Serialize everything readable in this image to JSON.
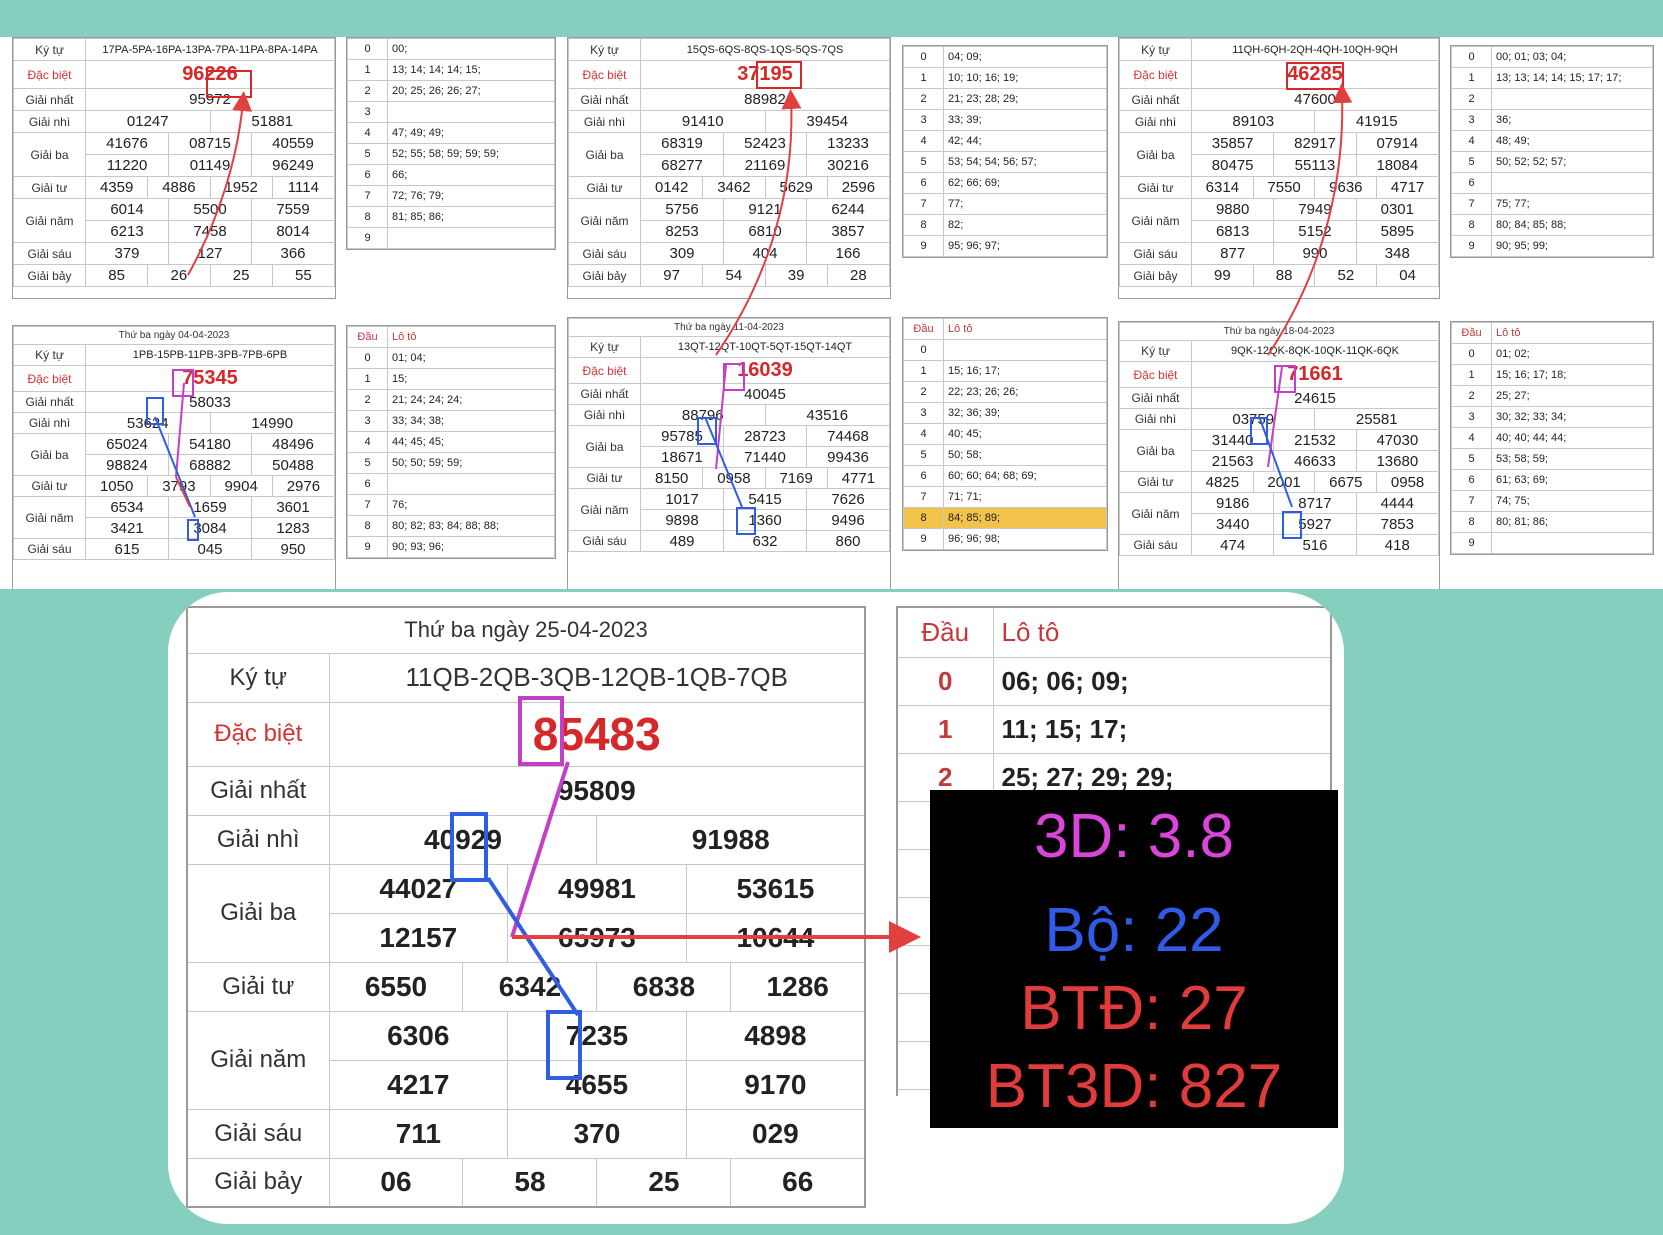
{
  "labels": {
    "ky_tu": "Ký tự",
    "dac_biet": "Đặc biệt",
    "giai_nhat": "Giải nhất",
    "giai_nhi": "Giải nhì",
    "giai_ba": "Giải ba",
    "giai_tu": "Giải tư",
    "giai_nam": "Giải năm",
    "giai_sau": "Giải sáu",
    "giai_bay": "Giải bảy",
    "dau": "Đầu",
    "loto": "Lô tô"
  },
  "cards": [
    {
      "id": "c1",
      "codes": "17PA-5PA-16PA-13PA-7PA-11PA-8PA-14PA",
      "db": "96226",
      "g1": "95972",
      "g2": [
        "01247",
        "51881"
      ],
      "g3": [
        "41676",
        "08715",
        "40559",
        "11220",
        "01149",
        "96249"
      ],
      "g4": [
        "4359",
        "4886",
        "1952",
        "1114"
      ],
      "g5": [
        "6014",
        "5500",
        "7559",
        "6213",
        "7458",
        "8014"
      ],
      "g6": [
        "379",
        "127",
        "366"
      ],
      "g7": [
        "85",
        "26",
        "25",
        "55"
      ]
    },
    {
      "id": "c2",
      "codes": "15QS-6QS-8QS-1QS-5QS-7QS",
      "db": "37195",
      "g1": "88982",
      "g2": [
        "91410",
        "39454"
      ],
      "g3": [
        "68319",
        "52423",
        "13233",
        "68277",
        "21169",
        "30216"
      ],
      "g4": [
        "0142",
        "3462",
        "5629",
        "2596"
      ],
      "g5": [
        "5756",
        "9121",
        "6244",
        "8253",
        "6810",
        "3857"
      ],
      "g6": [
        "309",
        "404",
        "166"
      ],
      "g7": [
        "97",
        "54",
        "39",
        "28"
      ]
    },
    {
      "id": "c3",
      "codes": "11QH-6QH-2QH-4QH-10QH-9QH",
      "db": "46285",
      "g1": "47600",
      "g2": [
        "89103",
        "41915"
      ],
      "g3": [
        "35857",
        "82917",
        "07914",
        "80475",
        "55113",
        "18084"
      ],
      "g4": [
        "6314",
        "7550",
        "9636",
        "4717"
      ],
      "g5": [
        "9880",
        "7949",
        "0301",
        "6813",
        "5152",
        "5895"
      ],
      "g6": [
        "877",
        "990",
        "348"
      ],
      "g7": [
        "99",
        "88",
        "52",
        "04"
      ]
    },
    {
      "id": "c4",
      "date": "Thứ ba ngày 04-04-2023",
      "codes": "1PB-15PB-11PB-3PB-7PB-6PB",
      "db": "75345",
      "g1": "58033",
      "g2": [
        "53624",
        "14990"
      ],
      "g3": [
        "65024",
        "54180",
        "48496",
        "98824",
        "68882",
        "50488"
      ],
      "g4": [
        "1050",
        "3793",
        "9904",
        "2976"
      ],
      "g5": [
        "6534",
        "1659",
        "3601",
        "3421",
        "3084",
        "1283"
      ],
      "g6": [
        "615",
        "045",
        "950"
      ]
    },
    {
      "id": "c5",
      "date": "Thứ ba ngày 11-04-2023",
      "codes": "13QT-12QT-10QT-5QT-15QT-14QT",
      "db": "16039",
      "g1": "40045",
      "g2": [
        "88796",
        "43516"
      ],
      "g3": [
        "95785",
        "28723",
        "74468",
        "18671",
        "71440",
        "99436"
      ],
      "g4": [
        "8150",
        "0958",
        "7169",
        "4771"
      ],
      "g5": [
        "1017",
        "5415",
        "7626",
        "9898",
        "1360",
        "9496"
      ],
      "g6": [
        "489",
        "632",
        "860"
      ]
    },
    {
      "id": "c6",
      "date": "Thứ ba ngày 18-04-2023",
      "codes": "9QK-12QK-8QK-10QK-11QK-6QK",
      "db": "71661",
      "g1": "24615",
      "g2": [
        "03759",
        "25581"
      ],
      "g3": [
        "31440",
        "21532",
        "47030",
        "21563",
        "46633",
        "13680"
      ],
      "g4": [
        "4825",
        "2001",
        "6675",
        "0958"
      ],
      "g5": [
        "9186",
        "8717",
        "4444",
        "3440",
        "5927",
        "7853"
      ],
      "g6": [
        "474",
        "516",
        "418"
      ]
    }
  ],
  "lotos": [
    {
      "id": "l1",
      "rows": [
        [
          "0",
          "00;"
        ],
        [
          "1",
          "13; 14; 14; 14; 15;"
        ],
        [
          "2",
          "20; 25; 26; 26; 27;"
        ],
        [
          "3",
          ""
        ],
        [
          "4",
          "47; 49; 49;"
        ],
        [
          "5",
          "52; 55; 58; 59; 59; 59;"
        ],
        [
          "6",
          "66;"
        ],
        [
          "7",
          "72; 76; 79;"
        ],
        [
          "8",
          "81; 85; 86;"
        ],
        [
          "9",
          ""
        ]
      ]
    },
    {
      "id": "l2",
      "rows": [
        [
          "0",
          "04; 09;"
        ],
        [
          "1",
          "10; 10; 16; 19;"
        ],
        [
          "2",
          "21; 23; 28; 29;"
        ],
        [
          "3",
          "33; 39;"
        ],
        [
          "4",
          "42; 44;"
        ],
        [
          "5",
          "53; 54; 54; 56; 57;"
        ],
        [
          "6",
          "62; 66; 69;"
        ],
        [
          "7",
          "77;"
        ],
        [
          "8",
          "82;"
        ],
        [
          "9",
          "95; 96; 97;"
        ]
      ]
    },
    {
      "id": "l3",
      "rows": [
        [
          "0",
          "00; 01; 03; 04;"
        ],
        [
          "1",
          "13; 13; 14; 14; 15; 17; 17;"
        ],
        [
          "2",
          ""
        ],
        [
          "3",
          "36;"
        ],
        [
          "4",
          "48; 49;"
        ],
        [
          "5",
          "50; 52; 52; 57;"
        ],
        [
          "6",
          ""
        ],
        [
          "7",
          "75; 77;"
        ],
        [
          "8",
          "80; 84; 85; 88;"
        ],
        [
          "9",
          "90; 95; 99;"
        ]
      ]
    },
    {
      "id": "l4",
      "rows": [
        [
          "0",
          "01; 04;"
        ],
        [
          "1",
          "15;"
        ],
        [
          "2",
          "21; 24; 24; 24;"
        ],
        [
          "3",
          "33; 34; 38;"
        ],
        [
          "4",
          "44; 45; 45;"
        ],
        [
          "5",
          "50; 50; 59; 59;"
        ],
        [
          "6",
          ""
        ],
        [
          "7",
          "76;"
        ],
        [
          "8",
          "80; 82; 83; 84; 88; 88;"
        ],
        [
          "9",
          "90; 93; 96;"
        ]
      ]
    },
    {
      "id": "l5",
      "rows": [
        [
          "0",
          ""
        ],
        [
          "1",
          "15; 16; 17;"
        ],
        [
          "2",
          "22; 23; 26; 26;"
        ],
        [
          "3",
          "32; 36; 39;"
        ],
        [
          "4",
          "40; 45;"
        ],
        [
          "5",
          "50; 58;"
        ],
        [
          "6",
          "60; 60; 64; 68; 69;"
        ],
        [
          "7",
          "71; 71;"
        ],
        [
          "8",
          "84; 85; 89;"
        ],
        [
          "9",
          "96; 96; 98;"
        ]
      ]
    },
    {
      "id": "l6",
      "rows": [
        [
          "0",
          "01; 02;"
        ],
        [
          "1",
          "15; 16; 17; 18;"
        ],
        [
          "2",
          "25; 27;"
        ],
        [
          "3",
          "30; 32; 33; 34;"
        ],
        [
          "4",
          "40; 40; 44; 44;"
        ],
        [
          "5",
          "53; 58; 59;"
        ],
        [
          "6",
          "61; 63; 69;"
        ],
        [
          "7",
          "74; 75;"
        ],
        [
          "8",
          "80; 81; 86;"
        ],
        [
          "9",
          ""
        ]
      ]
    }
  ],
  "big": {
    "date": "Thứ ba ngày 25-04-2023",
    "codes": "11QB-2QB-3QB-12QB-1QB-7QB",
    "db": "85483",
    "g1": "95809",
    "g2": [
      "40929",
      "91988"
    ],
    "g3": [
      "44027",
      "49981",
      "53615",
      "12157",
      "65973",
      "10644"
    ],
    "g4": [
      "6550",
      "6342",
      "6838",
      "1286"
    ],
    "g5": [
      "6306",
      "7235",
      "4898",
      "4217",
      "4655",
      "9170"
    ],
    "g6": [
      "711",
      "370",
      "029"
    ],
    "g7": [
      "06",
      "58",
      "25",
      "66"
    ]
  },
  "big_loto": [
    [
      "0",
      "06; 06; 09;"
    ],
    [
      "1",
      "11; 15; 17;"
    ],
    [
      "2",
      "25; 27; 29; 29;"
    ]
  ],
  "stats": {
    "l1": "3D: 3.8",
    "l2": "Bộ: 22",
    "l3": "BTĐ: 27",
    "l4": "BT3D: 827",
    "c1": "#d946d9",
    "c2": "#2f5be8",
    "c3": "#e23b3b",
    "c4": "#e23b3b"
  }
}
